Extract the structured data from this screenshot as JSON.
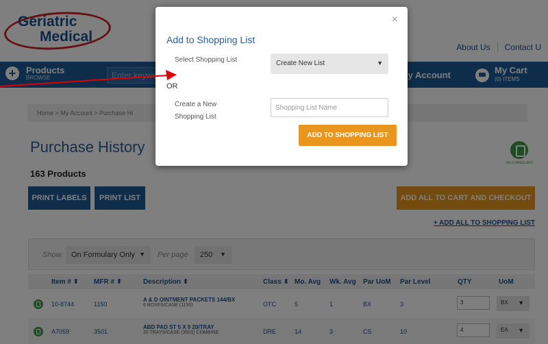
{
  "logo": {
    "line1": "Geriatric",
    "line2": "Medical"
  },
  "top_links": [
    "About Us",
    "Contact U"
  ],
  "nav": {
    "products_label": "Products",
    "products_sub": "BROWSE",
    "search_placeholder": "Enter keywo",
    "account_label": "ly Account",
    "cart_label": "My Cart",
    "cart_sub": "(0) ITEMS"
  },
  "breadcrumb": "Home  >  My Account  >  Purchase Hi",
  "page_title": "Purchase History",
  "formulary_badge": "ON FORMULARY",
  "product_count": "163 Products",
  "buttons": {
    "print_labels": "PRINT LABELS",
    "print_list": "PRINT LIST",
    "add_all_checkout": "ADD ALL TO CART AND CHECKOUT",
    "add_all_shopping_list": "+ ADD ALL TO SHOPPING LIST"
  },
  "filter": {
    "show_label": "Show:",
    "show_value": "On Formulary Only",
    "per_page_label": "Per page",
    "per_page_value": "250"
  },
  "table": {
    "headers": [
      "Item # ⬍",
      "MFR # ⬍",
      "Description ⬍",
      "Class ⬍",
      "Mo. Avg",
      "Wk. Avg",
      "Par UoM",
      "Par Level",
      "QTY",
      "UoM"
    ],
    "rows": [
      {
        "item": "10-8744",
        "mfr": "1150",
        "desc": "A & D OINTMENT PACKETS 144/BX",
        "desc_sub": "6 BOXES/CASE (1150)",
        "class": "OTC",
        "mo_avg": "5",
        "wk_avg": "1",
        "par_uom": "BX",
        "par_level": "3",
        "qty": "3",
        "uom": "BX"
      },
      {
        "item": "A7059",
        "mfr": "3501",
        "desc": "ABD PAD ST 5 X 9 20/TRAY",
        "desc_sub": "20 TRAYS/CASE (3501) COMBINE",
        "class": "DRE",
        "mo_avg": "14",
        "wk_avg": "3",
        "par_uom": "CS",
        "par_level": "10",
        "qty": "4",
        "uom": "EA"
      }
    ]
  },
  "modal": {
    "title": "Add to Shopping List",
    "close": "×",
    "select_label": "Select Shopping List",
    "select_value": "Create New List",
    "or_label": "OR",
    "create_label_line1": "Create a New",
    "create_label_line2": "Shopping List",
    "name_placeholder": "Shopping List Name",
    "submit": "ADD TO SHOPPING LIST"
  },
  "colors": {
    "brand_blue": "#1c5a95",
    "accent_orange": "#e8961e",
    "formulary_green": "#3e9b47",
    "annotation_red": "#e00000"
  }
}
